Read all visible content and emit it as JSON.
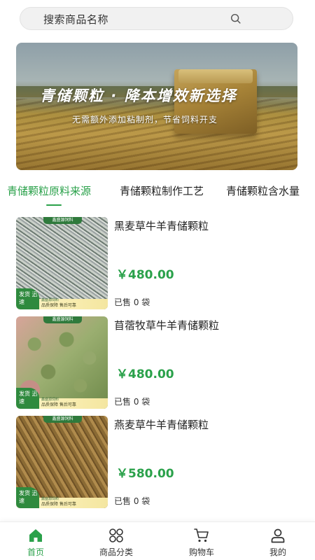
{
  "search": {
    "placeholder": "搜索商品名称",
    "icon": "search-icon"
  },
  "banner": {
    "title": "青储颗粒 · 降本增效新选择",
    "subtitle": "无需额外添加粘制剂，节省饲料开支"
  },
  "tabs": [
    {
      "label": "青储颗粒原料来源",
      "active": true
    },
    {
      "label": "青储颗粒制作工艺",
      "active": false
    },
    {
      "label": "青储颗粒含水量",
      "active": false
    }
  ],
  "products": [
    {
      "name": "黑麦草牛羊青储颗粒",
      "price": "￥480.00",
      "sold": "已售 0 袋"
    },
    {
      "name": "苜蓿牧草牛羊青储颗粒",
      "price": "￥480.00",
      "sold": "已售 0 袋"
    },
    {
      "name": "燕麦草牛羊青储颗粒",
      "price": "￥580.00",
      "sold": "已售 0 袋"
    }
  ],
  "thumb_badge": {
    "cap": "鑫盛源饲料",
    "ship": "发货 迅速",
    "bar_label": "鑫盛源饲料",
    "bar_text": "品质保障 售后可靠"
  },
  "tabbar": [
    {
      "label": "首页",
      "icon": "home-icon",
      "active": true
    },
    {
      "label": "商品分类",
      "icon": "category-icon",
      "active": false
    },
    {
      "label": "购物车",
      "icon": "cart-icon",
      "active": false
    },
    {
      "label": "我的",
      "icon": "user-icon",
      "active": false
    }
  ],
  "colors": {
    "accent": "#2aa14a",
    "badge_green": "#2f8a3e"
  }
}
